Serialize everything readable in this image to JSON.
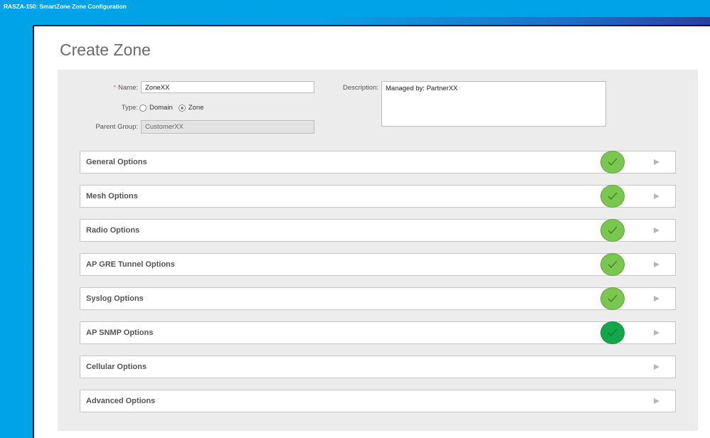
{
  "window_title": "RASZA-150: SmartZone Zone Configuration",
  "page_title": "Create Zone",
  "form": {
    "name_label": "Name:",
    "name_required_mark": "*",
    "name_value": "ZoneXX",
    "type_label": "Type:",
    "type_options": [
      "Domain",
      "Zone"
    ],
    "type_selected": "Zone",
    "parent_group_label": "Parent Group:",
    "parent_group_value": "CustomerXX",
    "description_label": "Description:",
    "description_value": "Managed by: PartnerXX"
  },
  "sections": [
    {
      "label": "General Options",
      "status": "complete"
    },
    {
      "label": "Mesh Options",
      "status": "complete"
    },
    {
      "label": "Radio Options",
      "status": "complete"
    },
    {
      "label": "AP GRE Tunnel Options",
      "status": "complete"
    },
    {
      "label": "Syslog Options",
      "status": "complete"
    },
    {
      "label": "AP SNMP Options",
      "status": "active"
    },
    {
      "label": "Cellular Options",
      "status": "none"
    },
    {
      "label": "Advanced Options",
      "status": "none"
    }
  ],
  "colors": {
    "check_complete": "#7ac74f",
    "check_active": "#12a84a",
    "required_mark": "#e8711a"
  },
  "icons": {
    "status": "check-circle-icon",
    "expand": "play-arrow-icon"
  }
}
